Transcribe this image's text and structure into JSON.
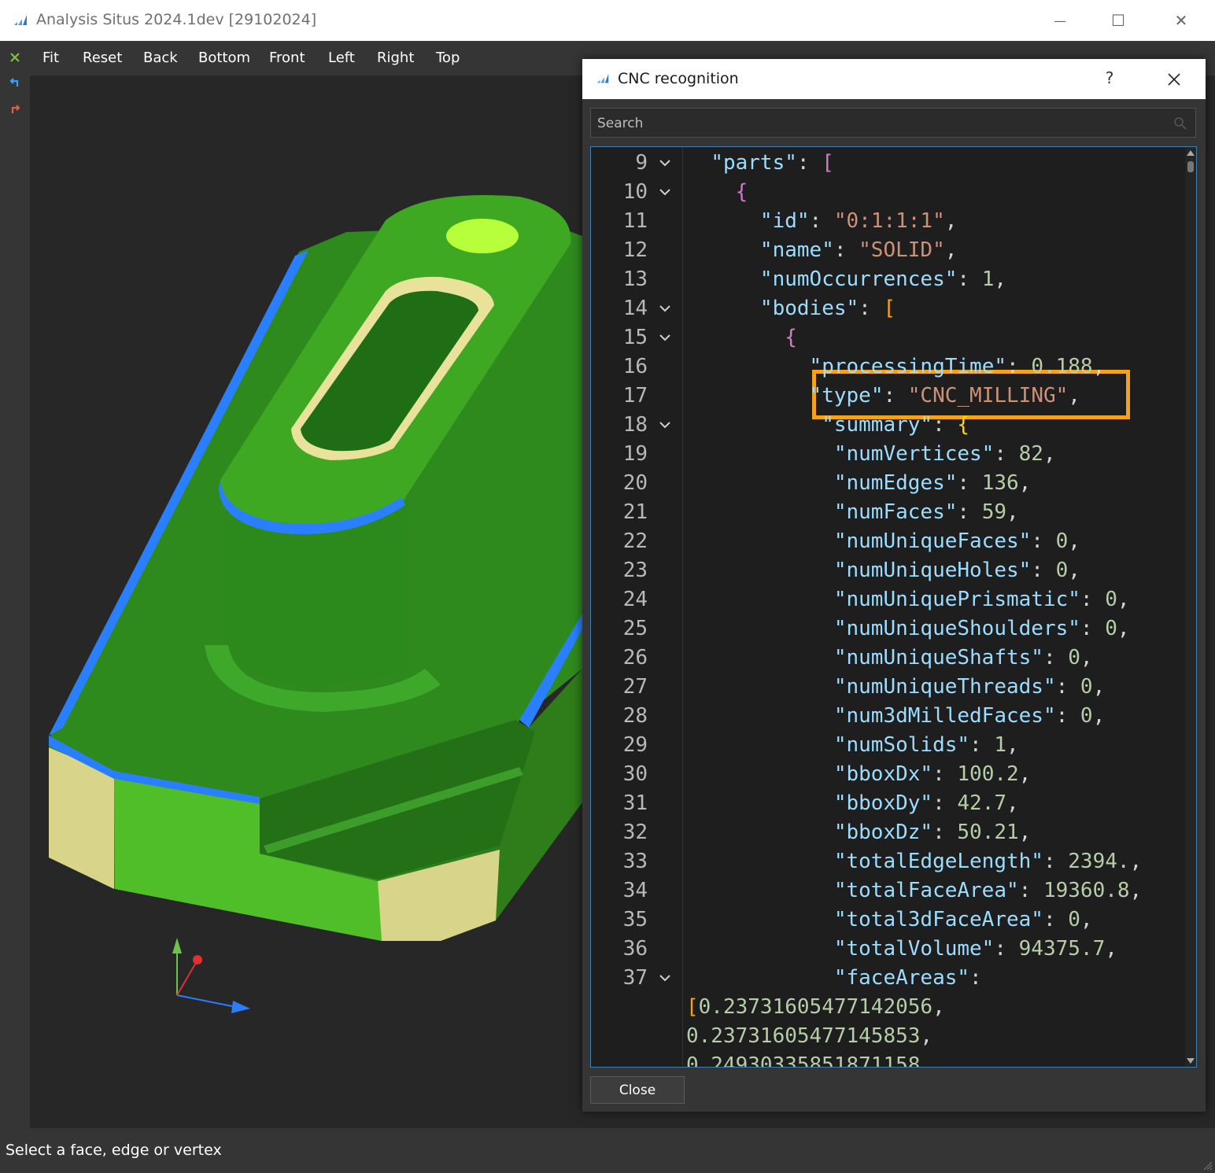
{
  "window": {
    "title": "Analysis Situs 2024.1dev [29102024]",
    "minimize_glyph": "—",
    "maximize_glyph": "☐",
    "close_glyph": "✕"
  },
  "left_toolbar": {
    "icons": [
      "close-selection-icon",
      "undo-icon",
      "redo-icon"
    ],
    "colors": [
      "#7fc241",
      "#3aa0ff",
      "#e06040"
    ]
  },
  "toolbar": {
    "items": [
      "Fit",
      "Reset",
      "Back",
      "Bottom",
      "Front",
      "Left",
      "Right",
      "Top"
    ]
  },
  "viewport": {
    "background": "#272727",
    "model_colors": {
      "top_face": "#4caf1e",
      "side_face": "#2e7d1a",
      "fillet": "#2a7fff",
      "hole_wall": "#e8e29a",
      "end_face": "#d8d48a",
      "small_hole": "#b6ff3a"
    },
    "axes": {
      "x": "#2d7bff",
      "y": "#6cc24a",
      "z": "#e03030"
    }
  },
  "status": {
    "text": "Select a face, edge or vertex"
  },
  "dialog": {
    "title": "CNC recognition",
    "help_label": "?",
    "search_placeholder": "Search",
    "close_label": "Close",
    "highlight_color": "#f5a21b",
    "lines": [
      {
        "n": "9",
        "fold": true,
        "tokens": [
          [
            "p",
            "  "
          ],
          [
            "k",
            "\"parts\""
          ],
          [
            "p",
            ": "
          ],
          [
            "b1",
            "["
          ]
        ]
      },
      {
        "n": "10",
        "fold": true,
        "tokens": [
          [
            "p",
            "    "
          ],
          [
            "b2",
            "{"
          ]
        ]
      },
      {
        "n": "11",
        "fold": false,
        "tokens": [
          [
            "p",
            "      "
          ],
          [
            "k",
            "\"id\""
          ],
          [
            "p",
            ": "
          ],
          [
            "s",
            "\"0:1:1:1\""
          ],
          [
            "p",
            ","
          ]
        ]
      },
      {
        "n": "12",
        "fold": false,
        "tokens": [
          [
            "p",
            "      "
          ],
          [
            "k",
            "\"name\""
          ],
          [
            "p",
            ": "
          ],
          [
            "s",
            "\"SOLID\""
          ],
          [
            "p",
            ","
          ]
        ]
      },
      {
        "n": "13",
        "fold": false,
        "tokens": [
          [
            "p",
            "      "
          ],
          [
            "k",
            "\"numOccurrences\""
          ],
          [
            "p",
            ": "
          ],
          [
            "n",
            "1"
          ],
          [
            "p",
            ","
          ]
        ]
      },
      {
        "n": "14",
        "fold": true,
        "tokens": [
          [
            "p",
            "      "
          ],
          [
            "k",
            "\"bodies\""
          ],
          [
            "p",
            ": "
          ],
          [
            "b4",
            "["
          ]
        ]
      },
      {
        "n": "15",
        "fold": true,
        "tokens": [
          [
            "p",
            "        "
          ],
          [
            "b1",
            "{"
          ]
        ]
      },
      {
        "n": "16",
        "fold": false,
        "tokens": [
          [
            "p",
            "          "
          ],
          [
            "k",
            "\"processingTime\""
          ],
          [
            "p",
            ": "
          ],
          [
            "n",
            "0.188"
          ],
          [
            "p",
            ","
          ]
        ]
      },
      {
        "n": "17",
        "fold": false,
        "tokens": [
          [
            "p",
            "          "
          ],
          [
            "k",
            "\"type\""
          ],
          [
            "p",
            ": "
          ],
          [
            "s",
            "\"CNC_MILLING\""
          ],
          [
            "p",
            ","
          ]
        ]
      },
      {
        "n": "18",
        "fold": true,
        "tokens": [
          [
            "p",
            "           "
          ],
          [
            "k",
            "\"summary\""
          ],
          [
            "p",
            ": "
          ],
          [
            "b3",
            "{"
          ]
        ]
      },
      {
        "n": "19",
        "fold": false,
        "tokens": [
          [
            "p",
            "            "
          ],
          [
            "k",
            "\"numVertices\""
          ],
          [
            "p",
            ": "
          ],
          [
            "n",
            "82"
          ],
          [
            "p",
            ","
          ]
        ]
      },
      {
        "n": "20",
        "fold": false,
        "tokens": [
          [
            "p",
            "            "
          ],
          [
            "k",
            "\"numEdges\""
          ],
          [
            "p",
            ": "
          ],
          [
            "n",
            "136"
          ],
          [
            "p",
            ","
          ]
        ]
      },
      {
        "n": "21",
        "fold": false,
        "tokens": [
          [
            "p",
            "            "
          ],
          [
            "k",
            "\"numFaces\""
          ],
          [
            "p",
            ": "
          ],
          [
            "n",
            "59"
          ],
          [
            "p",
            ","
          ]
        ]
      },
      {
        "n": "22",
        "fold": false,
        "tokens": [
          [
            "p",
            "            "
          ],
          [
            "k",
            "\"numUniqueFaces\""
          ],
          [
            "p",
            ": "
          ],
          [
            "n",
            "0"
          ],
          [
            "p",
            ","
          ]
        ]
      },
      {
        "n": "23",
        "fold": false,
        "tokens": [
          [
            "p",
            "            "
          ],
          [
            "k",
            "\"numUniqueHoles\""
          ],
          [
            "p",
            ": "
          ],
          [
            "n",
            "0"
          ],
          [
            "p",
            ","
          ]
        ]
      },
      {
        "n": "24",
        "fold": false,
        "tokens": [
          [
            "p",
            "            "
          ],
          [
            "k",
            "\"numUniquePrismatic\""
          ],
          [
            "p",
            ": "
          ],
          [
            "n",
            "0"
          ],
          [
            "p",
            ","
          ]
        ]
      },
      {
        "n": "25",
        "fold": false,
        "tokens": [
          [
            "p",
            "            "
          ],
          [
            "k",
            "\"numUniqueShoulders\""
          ],
          [
            "p",
            ": "
          ],
          [
            "n",
            "0"
          ],
          [
            "p",
            ","
          ]
        ]
      },
      {
        "n": "26",
        "fold": false,
        "tokens": [
          [
            "p",
            "            "
          ],
          [
            "k",
            "\"numUniqueShafts\""
          ],
          [
            "p",
            ": "
          ],
          [
            "n",
            "0"
          ],
          [
            "p",
            ","
          ]
        ]
      },
      {
        "n": "27",
        "fold": false,
        "tokens": [
          [
            "p",
            "            "
          ],
          [
            "k",
            "\"numUniqueThreads\""
          ],
          [
            "p",
            ": "
          ],
          [
            "n",
            "0"
          ],
          [
            "p",
            ","
          ]
        ]
      },
      {
        "n": "28",
        "fold": false,
        "tokens": [
          [
            "p",
            "            "
          ],
          [
            "k",
            "\"num3dMilledFaces\""
          ],
          [
            "p",
            ": "
          ],
          [
            "n",
            "0"
          ],
          [
            "p",
            ","
          ]
        ]
      },
      {
        "n": "29",
        "fold": false,
        "tokens": [
          [
            "p",
            "            "
          ],
          [
            "k",
            "\"numSolids\""
          ],
          [
            "p",
            ": "
          ],
          [
            "n",
            "1"
          ],
          [
            "p",
            ","
          ]
        ]
      },
      {
        "n": "30",
        "fold": false,
        "tokens": [
          [
            "p",
            "            "
          ],
          [
            "k",
            "\"bboxDx\""
          ],
          [
            "p",
            ": "
          ],
          [
            "n",
            "100.2"
          ],
          [
            "p",
            ","
          ]
        ]
      },
      {
        "n": "31",
        "fold": false,
        "tokens": [
          [
            "p",
            "            "
          ],
          [
            "k",
            "\"bboxDy\""
          ],
          [
            "p",
            ": "
          ],
          [
            "n",
            "42.7"
          ],
          [
            "p",
            ","
          ]
        ]
      },
      {
        "n": "32",
        "fold": false,
        "tokens": [
          [
            "p",
            "            "
          ],
          [
            "k",
            "\"bboxDz\""
          ],
          [
            "p",
            ": "
          ],
          [
            "n",
            "50.21"
          ],
          [
            "p",
            ","
          ]
        ]
      },
      {
        "n": "33",
        "fold": false,
        "tokens": [
          [
            "p",
            "            "
          ],
          [
            "k",
            "\"totalEdgeLength\""
          ],
          [
            "p",
            ": "
          ],
          [
            "n",
            "2394."
          ],
          [
            "p",
            ","
          ]
        ]
      },
      {
        "n": "34",
        "fold": false,
        "tokens": [
          [
            "p",
            "            "
          ],
          [
            "k",
            "\"totalFaceArea\""
          ],
          [
            "p",
            ": "
          ],
          [
            "n",
            "19360.8"
          ],
          [
            "p",
            ","
          ]
        ]
      },
      {
        "n": "35",
        "fold": false,
        "tokens": [
          [
            "p",
            "            "
          ],
          [
            "k",
            "\"total3dFaceArea\""
          ],
          [
            "p",
            ": "
          ],
          [
            "n",
            "0"
          ],
          [
            "p",
            ","
          ]
        ]
      },
      {
        "n": "36",
        "fold": false,
        "tokens": [
          [
            "p",
            "            "
          ],
          [
            "k",
            "\"totalVolume\""
          ],
          [
            "p",
            ": "
          ],
          [
            "n",
            "94375.7"
          ],
          [
            "p",
            ","
          ]
        ]
      },
      {
        "n": "37",
        "fold": true,
        "tokens": [
          [
            "p",
            "            "
          ],
          [
            "k",
            "\"faceAreas\""
          ],
          [
            "p",
            ":"
          ]
        ]
      },
      {
        "n": "",
        "fold": false,
        "tokens": [
          [
            "b4",
            "["
          ],
          [
            "n",
            "0.23731605477142056"
          ],
          [
            "p",
            ","
          ]
        ]
      },
      {
        "n": "",
        "fold": false,
        "tokens": [
          [
            "n",
            "0.23731605477145853"
          ],
          [
            "p",
            ","
          ]
        ]
      },
      {
        "n": "",
        "fold": false,
        "tokens": [
          [
            "n",
            "0.24930335851871158"
          ]
        ]
      }
    ]
  }
}
